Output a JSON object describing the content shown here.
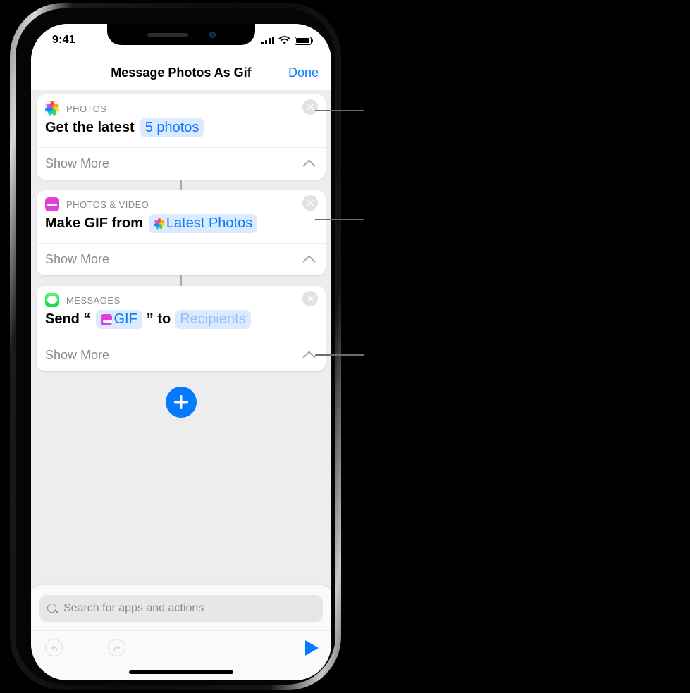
{
  "status_bar": {
    "time": "9:41",
    "signal_icon": "cellular-signal-icon",
    "wifi_icon": "wifi-icon",
    "battery_icon": "battery-full-icon"
  },
  "nav": {
    "title": "Message Photos As Gif",
    "done_label": "Done"
  },
  "actions": [
    {
      "app_label": "PHOTOS",
      "app_icon": "photos-app-icon",
      "close_icon": "close-circle-icon",
      "text_before": "Get the latest",
      "token": "5 photos",
      "token_kind": "value",
      "token_icon": null,
      "text_after": "",
      "show_more_label": "Show More",
      "chevron_icon": "chevron-up-icon"
    },
    {
      "app_label": "PHOTOS & VIDEO",
      "app_icon": "photos-video-app-icon",
      "close_icon": "close-circle-icon",
      "text_before": "Make GIF from",
      "token": "Latest Photos",
      "token_kind": "variable",
      "token_icon": "photos-app-icon",
      "text_after": "",
      "show_more_label": "Show More",
      "chevron_icon": "chevron-up-icon"
    },
    {
      "app_label": "MESSAGES",
      "app_icon": "messages-app-icon",
      "close_icon": "close-circle-icon",
      "text_before": "Send “",
      "token": "GIF",
      "token_kind": "variable",
      "token_icon": "photos-video-app-icon",
      "text_after": "” to",
      "token2": "Recipients",
      "token2_kind": "placeholder",
      "show_more_label": "Show More",
      "chevron_icon": "chevron-up-icon"
    }
  ],
  "add_action": {
    "icon": "plus-icon"
  },
  "search": {
    "placeholder": "Search for apps and actions",
    "icon": "search-icon"
  },
  "toolbar": {
    "undo_icon": "undo-arrow-icon",
    "redo_icon": "redo-arrow-icon",
    "run_icon": "play-triangle-icon"
  },
  "colors": {
    "accent_blue": "#047aff",
    "token_background": "#dbeafe",
    "placeholder_blue": "#8cc0fb",
    "photos_video_magenta": "#e040d8",
    "messages_green": "#1bd63d",
    "screen_background": "#ededf0",
    "card_white": "#ffffff",
    "muted_gray": "#8a8a8e"
  }
}
